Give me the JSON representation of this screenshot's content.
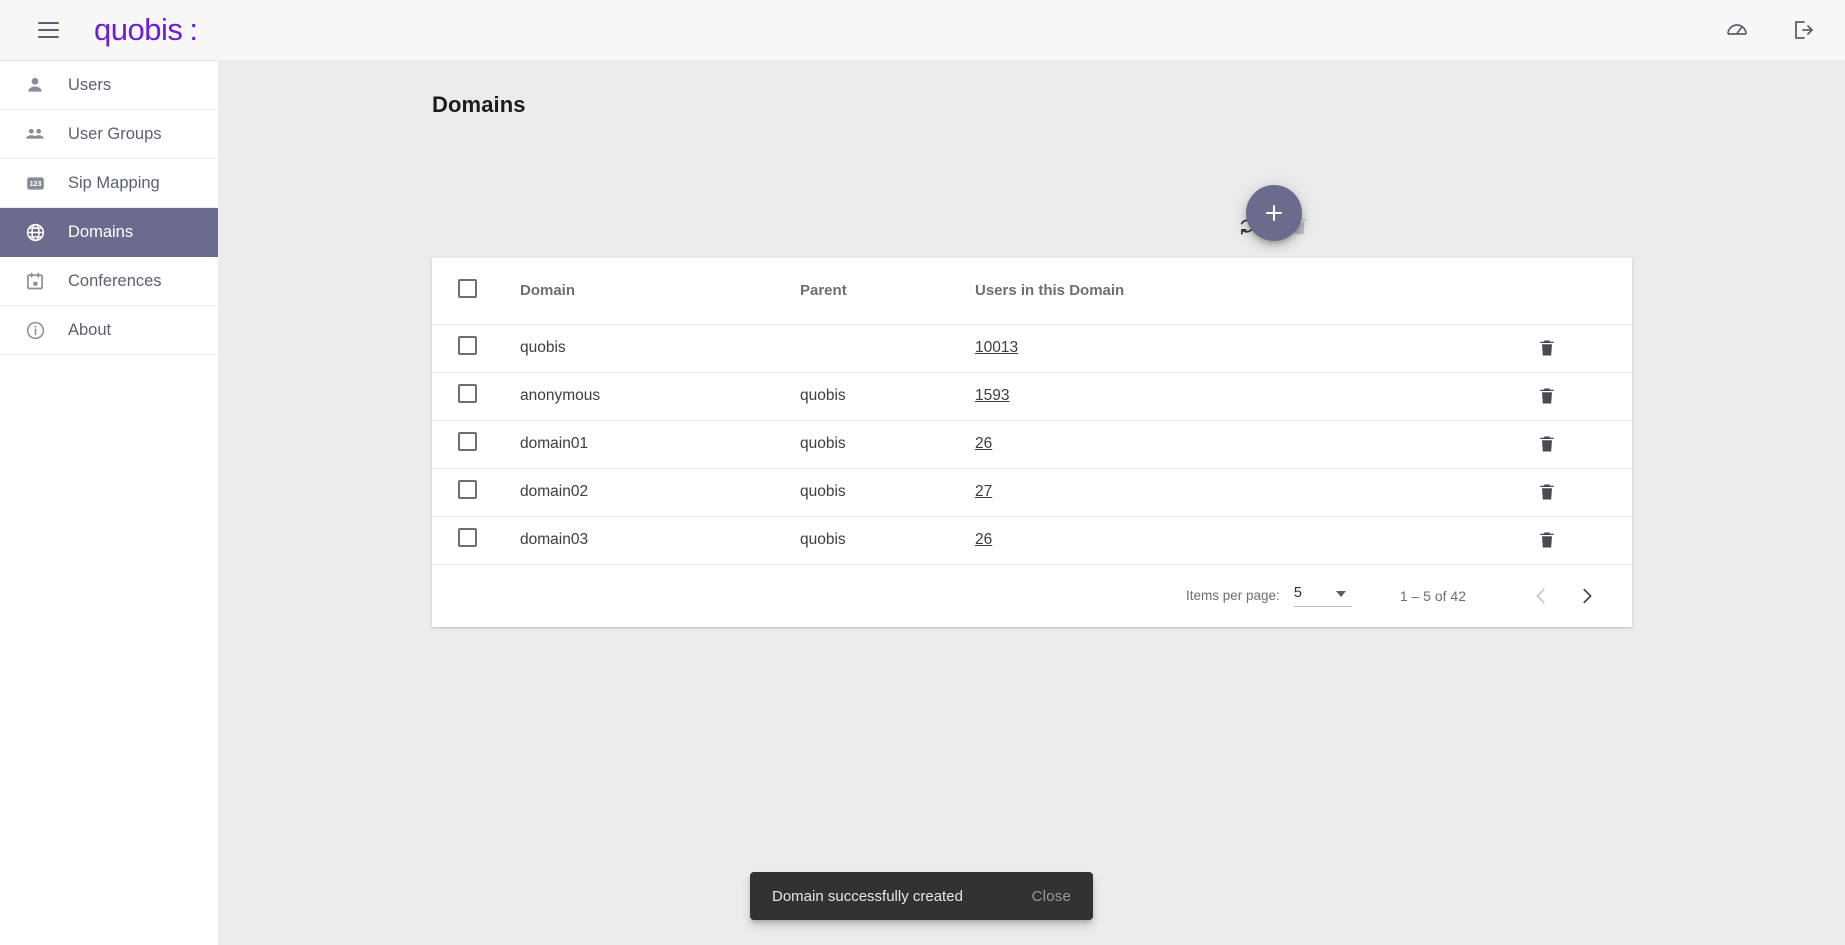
{
  "appbar": {
    "menu_icon": "hamburger-menu-icon",
    "brand": "quobis",
    "brand_mark": ":",
    "brand_color": "#6d1fd6",
    "right_icons": [
      {
        "name": "dashboard-icon",
        "label": "Dashboard"
      },
      {
        "name": "logout-icon",
        "label": "Logout"
      }
    ]
  },
  "sidebar": {
    "items": [
      {
        "label": "Users",
        "icon": "person-icon",
        "active": false
      },
      {
        "label": "User Groups",
        "icon": "people-group-icon",
        "active": false
      },
      {
        "label": "Sip Mapping",
        "icon": "numbers-123-icon",
        "active": false
      },
      {
        "label": "Domains",
        "icon": "globe-icon",
        "active": true
      },
      {
        "label": "Conferences",
        "icon": "calendar-icon",
        "active": false
      },
      {
        "label": "About",
        "icon": "info-circle-icon",
        "active": false
      }
    ],
    "active_bg": "#6b6b8d"
  },
  "main": {
    "title": "Domains",
    "toolbar": {
      "refresh_label": "Refresh",
      "delete_label": "Delete",
      "add_label": "Add domain",
      "add_glyph": "+",
      "delete_enabled": false
    },
    "table": {
      "columns": [
        "Domain",
        "Parent",
        "Users in this Domain"
      ],
      "rows": [
        {
          "selected": false,
          "domain": "quobis",
          "parent": "",
          "users": "10013"
        },
        {
          "selected": false,
          "domain": "anonymous",
          "parent": "quobis",
          "users": "1593"
        },
        {
          "selected": false,
          "domain": "domain01",
          "parent": "quobis",
          "users": "26"
        },
        {
          "selected": false,
          "domain": "domain02",
          "parent": "quobis",
          "users": "27"
        },
        {
          "selected": false,
          "domain": "domain03",
          "parent": "quobis",
          "users": "26"
        }
      ]
    },
    "paginator": {
      "items_per_page_label": "Items per page:",
      "items_per_page_value": "5",
      "range_label": "1 – 5 of 42",
      "prev_enabled": false,
      "next_enabled": true
    }
  },
  "snackbar": {
    "message": "Domain successfully created",
    "action": "Close"
  }
}
